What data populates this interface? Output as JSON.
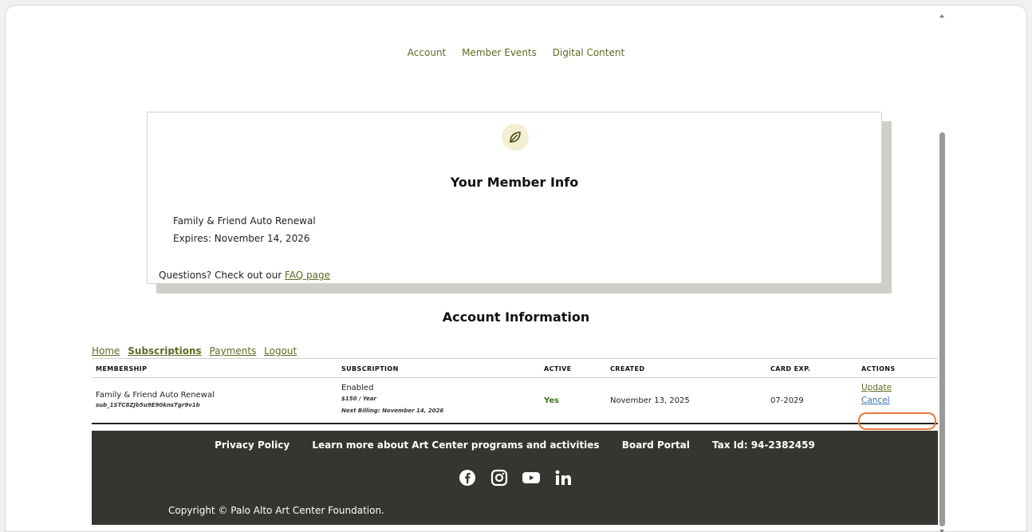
{
  "topnav": [
    "Account",
    "Member Events",
    "Digital Content"
  ],
  "member_card": {
    "icon": "leaf-icon",
    "title": "Your Member Info",
    "membership": "Family & Friend Auto Renewal",
    "expires": "Expires: November 14, 2026",
    "questions_prefix": "Questions? Check out our ",
    "faq_link": "FAQ page"
  },
  "account_title": "Account Information",
  "subnav": [
    {
      "label": "Home",
      "active": false
    },
    {
      "label": "Subscriptions",
      "active": true
    },
    {
      "label": "Payments",
      "active": false
    },
    {
      "label": "Logout",
      "active": false
    }
  ],
  "table": {
    "headers": [
      "MEMBERSHIP",
      "SUBSCRIPTION",
      "ACTIVE",
      "CREATED",
      "CARD EXP.",
      "ACTIONS"
    ],
    "rows": [
      {
        "membership": "Family & Friend Auto Renewal",
        "sub_id": "sub_1STC8ZJb5u9E90knsTgr9v1b",
        "status": "Enabled",
        "price": "$150 / Year",
        "next_billing": "Next Billing: November 14, 2026",
        "active": "Yes",
        "created": "November 13, 2025",
        "card_exp": "07-2029",
        "action_update": "Update",
        "action_cancel": "Cancel"
      }
    ]
  },
  "footer": {
    "links": [
      "Privacy Policy",
      "Learn more about Art Center programs and activities",
      "Board Portal",
      "Tax Id: 94-2382459"
    ],
    "social": [
      "facebook-icon",
      "instagram-icon",
      "youtube-icon",
      "linkedin-icon"
    ],
    "copyright": "Copyright © Palo Alto Art Center Foundation."
  },
  "colors": {
    "link_green": "#5b6b22",
    "footer_bg": "#37352f",
    "highlight": "#e97c37",
    "cancel_blue": "#3f6fb2"
  }
}
